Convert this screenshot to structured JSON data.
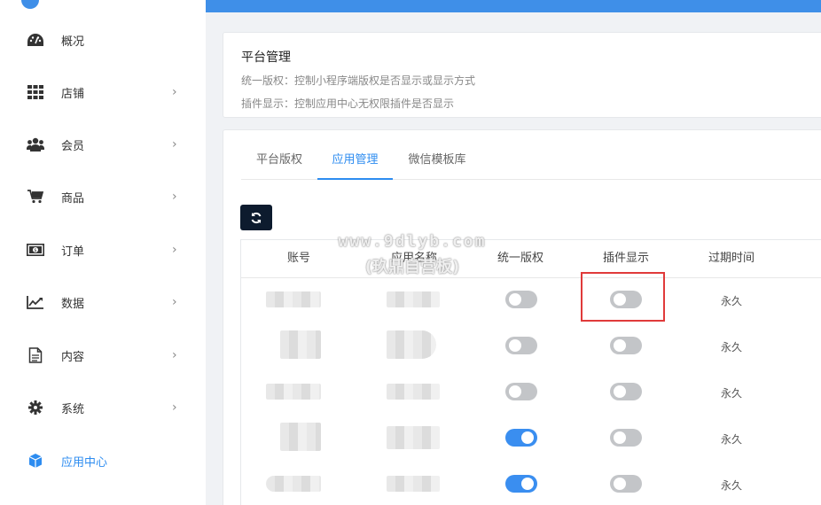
{
  "sidebar": {
    "items": [
      {
        "label": "概况",
        "icon": "dashboard-icon",
        "has_chevron": false
      },
      {
        "label": "店铺",
        "icon": "grid-icon",
        "has_chevron": true
      },
      {
        "label": "会员",
        "icon": "users-icon",
        "has_chevron": true
      },
      {
        "label": "商品",
        "icon": "cart-icon",
        "has_chevron": true
      },
      {
        "label": "订单",
        "icon": "money-icon",
        "has_chevron": true
      },
      {
        "label": "数据",
        "icon": "line-chart-icon",
        "has_chevron": true
      },
      {
        "label": "内容",
        "icon": "document-icon",
        "has_chevron": true
      },
      {
        "label": "系统",
        "icon": "gear-icon",
        "has_chevron": true
      },
      {
        "label": "应用中心",
        "icon": "cube-icon",
        "has_chevron": false,
        "active": true
      }
    ],
    "chevron": "›"
  },
  "info_card": {
    "title": "平台管理",
    "desc1": "统一版权：控制小程序端版权是否显示或显示方式",
    "desc2": "插件显示：控制应用中心无权限插件是否显示"
  },
  "tabs": [
    {
      "label": "平台版权",
      "active": false
    },
    {
      "label": "应用管理",
      "active": true
    },
    {
      "label": "微信模板库",
      "active": false
    }
  ],
  "table": {
    "headers": [
      "账号",
      "应用名称",
      "统一版权",
      "插件显示",
      "过期时间"
    ],
    "rows": [
      {
        "copyright_on": false,
        "plugin_on": false,
        "expire": "永久"
      },
      {
        "copyright_on": false,
        "plugin_on": false,
        "expire": "永久"
      },
      {
        "copyright_on": false,
        "plugin_on": false,
        "expire": "永久"
      },
      {
        "copyright_on": true,
        "plugin_on": false,
        "expire": "永久"
      },
      {
        "copyright_on": true,
        "plugin_on": false,
        "expire": "永久"
      }
    ]
  },
  "watermark": {
    "line1": "www.9dlyb.com",
    "line2": "(玖鼎自营板)"
  },
  "colors": {
    "accent": "#2d8cf0",
    "topbar": "#3f8fe8",
    "highlight": "#e03a3a",
    "switch_on": "#3a8ef0",
    "switch_off": "#c3c5c8"
  }
}
